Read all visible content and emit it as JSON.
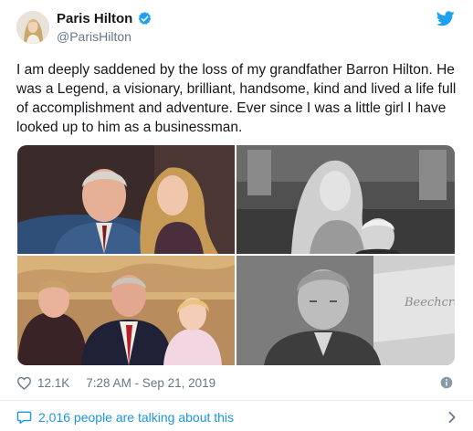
{
  "author": {
    "name": "Paris Hilton",
    "handle": "@ParisHilton",
    "avatar_icon": "profile-photo-icon",
    "verified_icon": "verified-badge-icon"
  },
  "tweet": {
    "text": "I am deeply saddened by the loss of my grandfather Barron Hilton. He was a Legend, a visionary, brilliant, handsome, kind and lived a life full of accomplishment and adventure. Ever since I was a little girl I have looked up to him as a businessman."
  },
  "media": {
    "photo4_logo_text": "Beechcraft"
  },
  "footer": {
    "likes": "12.1K",
    "timestamp": "7:28 AM - Sep 21, 2019",
    "info_icon": "info-icon",
    "talking": "2,016 people are talking about this"
  },
  "colors": {
    "accent": "#1da1f2",
    "link": "#1b95e0",
    "meta": "#657786"
  }
}
